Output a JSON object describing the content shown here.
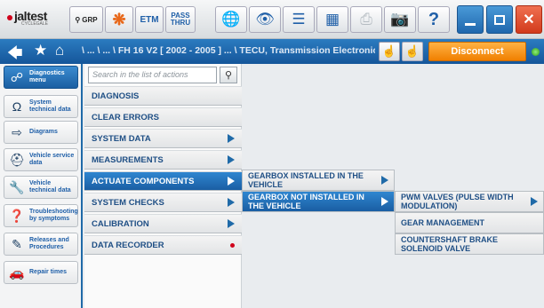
{
  "toolbar": {
    "logo": "jaltest",
    "logo_sub": "CYCLEGALE",
    "grp_label": "GRP",
    "etm_label": "ETM",
    "pass_thru_label": "PASS THRU",
    "help_label": "?"
  },
  "nav": {
    "breadcrumb": "\\ ... \\ ... \\ FH 16 V2 [ 2002 - 2005 ] ... \\ TECU, Transmission Electronic Cont...",
    "disconnect_label": "Disconnect",
    "status_color": "#3bb317"
  },
  "sidebar": {
    "items": [
      {
        "label": "Diagnostics menu",
        "icon": "diagnostics-icon"
      },
      {
        "label": "System technical data",
        "icon": "ohm-icon"
      },
      {
        "label": "Diagrams",
        "icon": "diagram-icon"
      },
      {
        "label": "Vehicle service data",
        "icon": "oil-can-icon"
      },
      {
        "label": "Vehicle technical data",
        "icon": "wrench-icon"
      },
      {
        "label": "Troubleshooting by symptoms",
        "icon": "troubleshooting-icon"
      },
      {
        "label": "Releases and Procedures",
        "icon": "procedures-icon"
      },
      {
        "label": "Repair times",
        "icon": "repair-times-icon"
      }
    ]
  },
  "actions": {
    "search_placeholder": "Search in the list of actions",
    "items": [
      {
        "label": "DIAGNOSIS"
      },
      {
        "label": "CLEAR ERRORS"
      },
      {
        "label": "SYSTEM DATA"
      },
      {
        "label": "MEASUREMENTS"
      },
      {
        "label": "ACTUATE COMPONENTS"
      },
      {
        "label": "SYSTEM CHECKS"
      },
      {
        "label": "CALIBRATION"
      },
      {
        "label": "DATA RECORDER"
      }
    ]
  },
  "submenu1": {
    "items": [
      {
        "label": "GEARBOX INSTALLED IN THE VEHICLE"
      },
      {
        "label": "GEARBOX NOT INSTALLED IN THE VEHICLE"
      }
    ]
  },
  "submenu2": {
    "items": [
      {
        "label": "PWM VALVES (PULSE WIDTH MODULATION)"
      },
      {
        "label": "GEAR MANAGEMENT"
      },
      {
        "label": "COUNTERSHAFT BRAKE SOLENOID VALVE"
      }
    ]
  }
}
